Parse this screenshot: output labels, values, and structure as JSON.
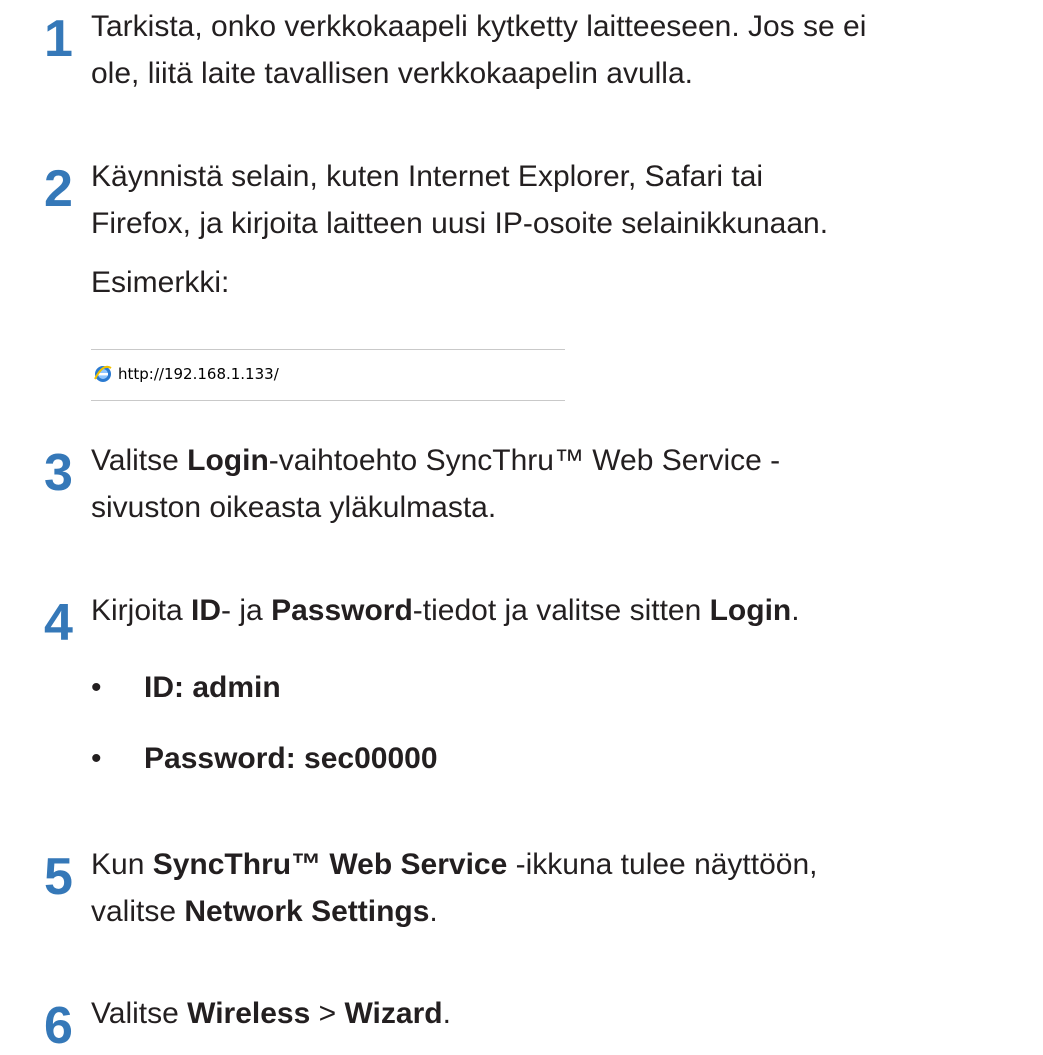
{
  "steps": [
    {
      "number": "1",
      "line1": "Tarkista, onko verkkokaapeli kytketty laitteeseen. Jos se ei",
      "line2": "ole, liitä laite tavallisen verkkokaapelin avulla."
    },
    {
      "number": "2",
      "line1": "Käynnistä selain, kuten Internet Explorer, Safari tai",
      "line2": "Firefox, ja kirjoita laitteen uusi IP-osoite selainikkunaan.",
      "example_label": "Esimerkki:"
    },
    {
      "number": "3",
      "bold1": "Login",
      "text1a": "Valitse ",
      "text1b": "-vaihtoehto SyncThru™ Web Service -",
      "line2": "sivuston oikeasta yläkulmasta."
    },
    {
      "number": "4",
      "text_a": "Kirjoita ",
      "bold_a": "ID",
      "text_b": "- ja ",
      "bold_b": "Password",
      "text_c": "-tiedot ja valitse sitten ",
      "bold_c": "Login",
      "text_d": ".",
      "bullets": [
        "ID: admin",
        "Password: sec00000"
      ],
      "bullet_symbol": "•"
    },
    {
      "number": "5",
      "text_a": "Kun ",
      "bold_a": "SyncThru™ Web Service",
      "text_b": " -ikkuna tulee näyttöön,",
      "text_c": "valitse ",
      "bold_b": "Network Settings",
      "text_d": "."
    },
    {
      "number": "6",
      "text_a": "Valitse ",
      "bold_a": "Wireless",
      "text_b": " > ",
      "bold_b": "Wizard",
      "text_c": "."
    }
  ],
  "address_bar": {
    "url": "http://192.168.1.133/",
    "icon": "internet-explorer-icon"
  },
  "colors": {
    "step_number": "#3578b8",
    "text": "#231f20"
  }
}
